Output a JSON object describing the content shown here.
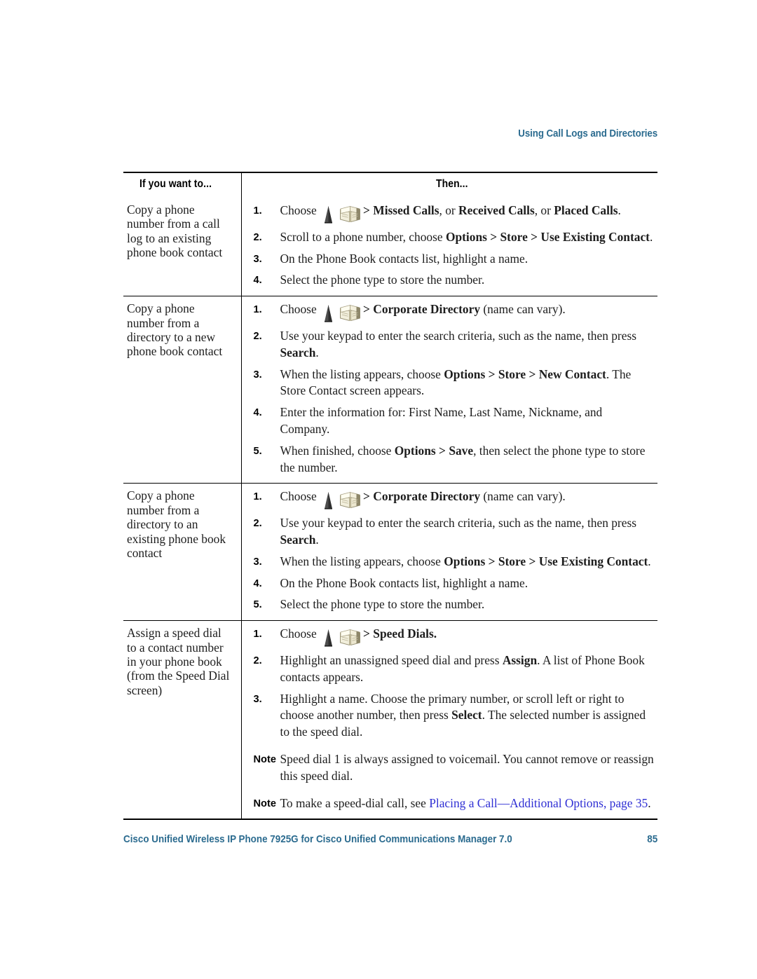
{
  "header": {
    "chapter_title": "Using Call Logs and Directories",
    "accent_color": "#2b6b8f"
  },
  "table": {
    "columns": [
      "If you want to...",
      "Then..."
    ],
    "rows": [
      {
        "task": "Copy a phone number from a call log to an existing phone book contact",
        "steps": [
          {
            "n": "1.",
            "segments": [
              {
                "t": "Choose ",
                "style": "normal"
              },
              {
                "t": "",
                "style": "icons"
              },
              {
                "t": "> ",
                "style": "bold"
              },
              {
                "t": "Missed Calls",
                "style": "bold"
              },
              {
                "t": ", or ",
                "style": "normal"
              },
              {
                "t": "Received Calls",
                "style": "bold"
              },
              {
                "t": ", or ",
                "style": "normal"
              },
              {
                "t": "Placed Calls",
                "style": "bold"
              },
              {
                "t": ".",
                "style": "normal"
              }
            ]
          },
          {
            "n": "2.",
            "segments": [
              {
                "t": "Scroll to a phone number, choose ",
                "style": "normal"
              },
              {
                "t": "Options",
                "style": "bold"
              },
              {
                "t": " > ",
                "style": "bold"
              },
              {
                "t": "Store",
                "style": "bold"
              },
              {
                "t": " > ",
                "style": "bold"
              },
              {
                "t": "Use Existing Contact",
                "style": "bold"
              },
              {
                "t": ".",
                "style": "normal"
              }
            ]
          },
          {
            "n": "3.",
            "segments": [
              {
                "t": "On the Phone Book contacts list, highlight a name.",
                "style": "normal"
              }
            ]
          },
          {
            "n": "4.",
            "segments": [
              {
                "t": "Select the phone type to store the number.",
                "style": "normal"
              }
            ]
          }
        ],
        "notes": []
      },
      {
        "task": "Copy a phone number from a directory to a new phone book contact",
        "steps": [
          {
            "n": "1.",
            "segments": [
              {
                "t": "Choose ",
                "style": "normal"
              },
              {
                "t": "",
                "style": "icons"
              },
              {
                "t": "> ",
                "style": "bold"
              },
              {
                "t": "Corporate Directory",
                "style": "bold"
              },
              {
                "t": " (name can vary).",
                "style": "normal"
              }
            ]
          },
          {
            "n": "2.",
            "segments": [
              {
                "t": "Use your keypad to enter the search criteria, such as the name, then press ",
                "style": "normal"
              },
              {
                "t": "Search",
                "style": "bold"
              },
              {
                "t": ".",
                "style": "normal"
              }
            ]
          },
          {
            "n": "3.",
            "segments": [
              {
                "t": "When the listing appears, choose ",
                "style": "normal"
              },
              {
                "t": "Options",
                "style": "bold"
              },
              {
                "t": " > ",
                "style": "bold"
              },
              {
                "t": "Store",
                "style": "bold"
              },
              {
                "t": " > ",
                "style": "bold"
              },
              {
                "t": "New Contact",
                "style": "bold"
              },
              {
                "t": ". The Store Contact screen appears.",
                "style": "normal"
              }
            ]
          },
          {
            "n": "4.",
            "segments": [
              {
                "t": "Enter the information for: First Name, Last Name, Nickname, and Company.",
                "style": "normal"
              }
            ]
          },
          {
            "n": "5.",
            "segments": [
              {
                "t": "When finished, choose ",
                "style": "normal"
              },
              {
                "t": "Options",
                "style": "bold"
              },
              {
                "t": " > ",
                "style": "bold"
              },
              {
                "t": "Save",
                "style": "bold"
              },
              {
                "t": ", then select the phone type to store the number.",
                "style": "normal"
              }
            ]
          }
        ],
        "notes": []
      },
      {
        "task": "Copy a phone number from a directory to an existing phone book contact",
        "steps": [
          {
            "n": "1.",
            "segments": [
              {
                "t": "Choose ",
                "style": "normal"
              },
              {
                "t": "",
                "style": "icons"
              },
              {
                "t": "> ",
                "style": "bold"
              },
              {
                "t": "Corporate Directory",
                "style": "bold"
              },
              {
                "t": " (name can vary).",
                "style": "normal"
              }
            ]
          },
          {
            "n": "2.",
            "segments": [
              {
                "t": "Use your keypad to enter the search criteria, such as the name, then press ",
                "style": "normal"
              },
              {
                "t": "Search",
                "style": "bold"
              },
              {
                "t": ".",
                "style": "normal"
              }
            ]
          },
          {
            "n": "3.",
            "segments": [
              {
                "t": "When the listing appears, choose ",
                "style": "normal"
              },
              {
                "t": "Options",
                "style": "bold"
              },
              {
                "t": " > ",
                "style": "bold"
              },
              {
                "t": "Store",
                "style": "bold"
              },
              {
                "t": " > ",
                "style": "bold"
              },
              {
                "t": "Use Existing Contact",
                "style": "bold"
              },
              {
                "t": ".",
                "style": "normal"
              }
            ]
          },
          {
            "n": "4.",
            "segments": [
              {
                "t": "On the Phone Book contacts list, highlight a name.",
                "style": "normal"
              }
            ]
          },
          {
            "n": "5.",
            "segments": [
              {
                "t": "Select the phone type to store the number.",
                "style": "normal"
              }
            ]
          }
        ],
        "notes": []
      },
      {
        "task": "Assign a speed dial to a contact number in your phone book (from the Speed Dial screen)",
        "steps": [
          {
            "n": "1.",
            "segments": [
              {
                "t": "Choose ",
                "style": "normal"
              },
              {
                "t": "",
                "style": "icons"
              },
              {
                "t": "> ",
                "style": "bold"
              },
              {
                "t": "Speed Dials",
                "style": "bold"
              },
              {
                "t": ".",
                "style": "bold"
              }
            ]
          },
          {
            "n": "2.",
            "segments": [
              {
                "t": "Highlight an unassigned speed dial and press ",
                "style": "normal"
              },
              {
                "t": "Assign",
                "style": "bold"
              },
              {
                "t": ". A list of Phone Book contacts appears.",
                "style": "normal"
              }
            ]
          },
          {
            "n": "3.",
            "segments": [
              {
                "t": "Highlight a name. Choose the primary number, or scroll left or right to choose another number, then press ",
                "style": "normal"
              },
              {
                "t": "Select",
                "style": "bold"
              },
              {
                "t": ". The selected number is assigned to the speed dial.",
                "style": "normal"
              }
            ]
          }
        ],
        "notes": [
          {
            "label": "Note",
            "segments": [
              {
                "t": "Speed dial 1 is always assigned to voicemail. You cannot remove or reassign this speed dial.",
                "style": "normal"
              }
            ]
          },
          {
            "label": "Note",
            "segments": [
              {
                "t": "To make a speed-dial call, see ",
                "style": "normal"
              },
              {
                "t": "Placing a Call—Additional Options, page 35",
                "style": "xref"
              },
              {
                "t": ".",
                "style": "normal"
              }
            ]
          }
        ]
      }
    ]
  },
  "icons": {
    "nav_cone": "navigation-cone-icon",
    "directory_book": "directory-book-icon"
  },
  "footer": {
    "title": "Cisco Unified Wireless IP Phone 7925G for Cisco Unified Communications Manager 7.0",
    "page_number": "85",
    "accent_color": "#2b6b8f"
  }
}
